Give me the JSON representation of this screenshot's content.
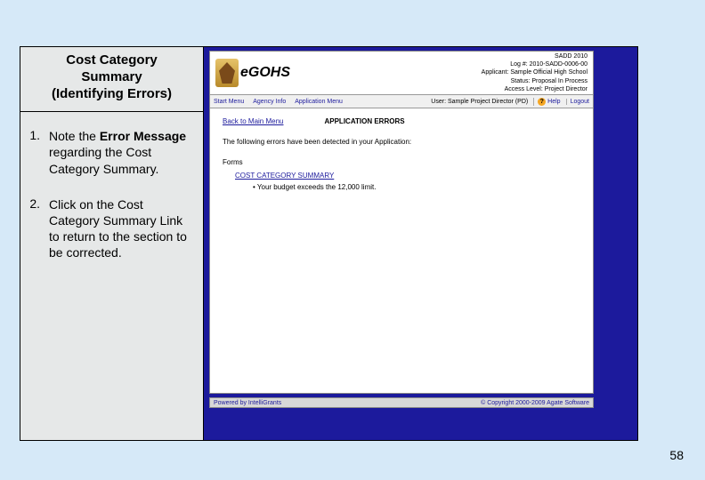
{
  "title": {
    "line1": "Cost Category",
    "line2": "Summary",
    "line3": "(Identifying Errors)"
  },
  "steps": [
    {
      "num": "1.",
      "prefix": "Note the ",
      "bold": "Error Message",
      "suffix": " regarding the Cost Category Summary."
    },
    {
      "num": "2.",
      "prefix": "Click on the Cost Category Summary Link to return to the section to be corrected.",
      "bold": "",
      "suffix": ""
    }
  ],
  "app": {
    "logo_text": "eGOHS",
    "header_info": {
      "l0": "SADD 2010",
      "l1": "Log #: 2010-SADD-0006-00",
      "l2": "Applicant: Sample Official High School",
      "l3": "Status: Proposal In Process",
      "l4": "Access Level: Project Director"
    },
    "menu": {
      "start": "Start Menu",
      "agency": "Agency Info",
      "appmenu": "Application Menu",
      "user": "User: Sample Project Director (PD)",
      "help": "Help",
      "logout": "Logout",
      "qmark": "?"
    },
    "content": {
      "back": "Back to Main Menu",
      "errors_heading": "APPLICATION ERRORS",
      "following": "The following errors have been detected in your Application:",
      "forms": "Forms",
      "ccs": "COST CATEGORY SUMMARY",
      "bullet": "Your budget exceeds the 12,000 limit."
    },
    "footer": {
      "left": "Powered by IntelliGrants",
      "right": "© Copyright 2000-2009 Agate Software"
    }
  },
  "pagenum": "58"
}
